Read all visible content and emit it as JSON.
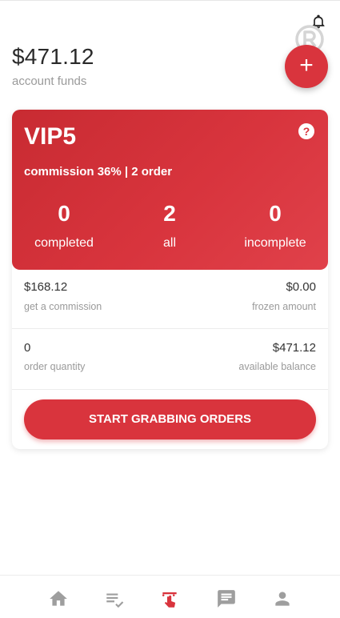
{
  "header": {
    "funds_amount": "$471.12",
    "funds_label": "account funds",
    "fab_label": "+",
    "icons": [
      "bell-icon",
      "registered-icon",
      "plus-icon"
    ]
  },
  "vip": {
    "level": "VIP5",
    "help": "?",
    "subtitle": "commission 36% | 2 order",
    "stats": [
      {
        "value": "0",
        "label": "completed"
      },
      {
        "value": "2",
        "label": "all"
      },
      {
        "value": "0",
        "label": "incomplete"
      }
    ]
  },
  "details": {
    "commission_value": "$168.12",
    "commission_label": "get a commission",
    "frozen_value": "$0.00",
    "frozen_label": "frozen amount",
    "orders_value": "0",
    "orders_label": "order quantity",
    "balance_value": "$471.12",
    "balance_label": "available balance"
  },
  "actions": {
    "grab_label": "START GRABBING ORDERS"
  },
  "nav": {
    "items": [
      {
        "icon": "home-icon",
        "active": false
      },
      {
        "icon": "list-check-icon",
        "active": false
      },
      {
        "icon": "tap-icon",
        "active": true
      },
      {
        "icon": "chat-icon",
        "active": false
      },
      {
        "icon": "person-icon",
        "active": false
      }
    ]
  },
  "colors": {
    "accent": "#d9343d",
    "muted": "#9a9a9a",
    "nav_inactive": "#9e9e9e"
  }
}
